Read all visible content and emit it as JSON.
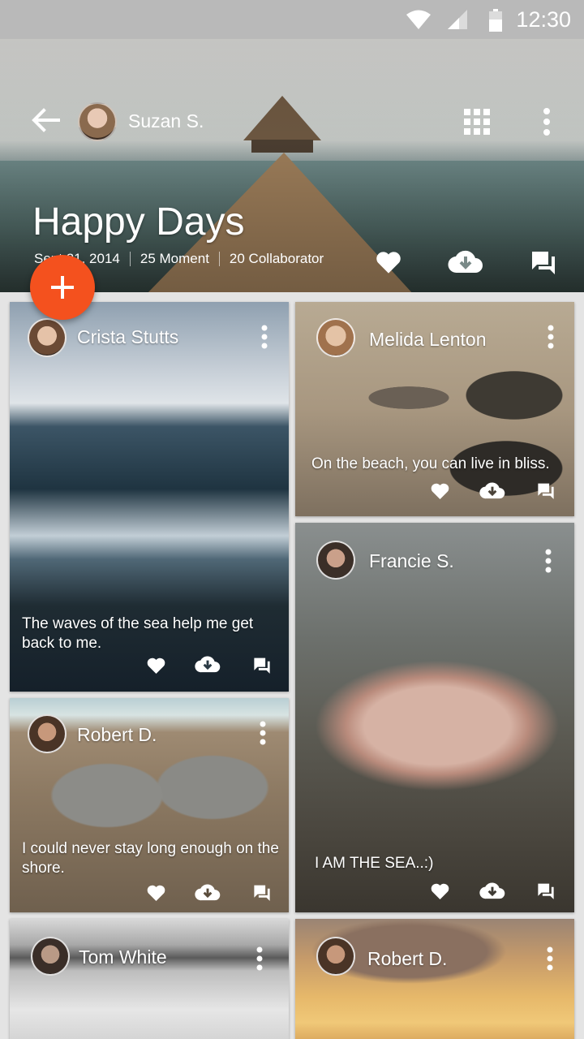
{
  "status_bar": {
    "time": "12:30"
  },
  "header": {
    "owner_name": "Suzan S.",
    "album_title": "Happy Days",
    "date": "Sept 21, 2014",
    "moments": "25 Moment",
    "collaborators": "20 Collaborator"
  },
  "colors": {
    "fab": "#f4511e",
    "status_bar": "#b9b9b9",
    "background": "#e4e4e4"
  },
  "cards": [
    {
      "name": "Crista Stutts",
      "caption": "The waves of the sea help me get back to me."
    },
    {
      "name": "Melida Lenton",
      "caption": "On the beach, you can live in bliss."
    },
    {
      "name": "Francie S.",
      "caption": "I AM THE SEA..:)"
    },
    {
      "name": "Robert D.",
      "caption": "I could never stay long enough on the shore."
    },
    {
      "name": "Tom White",
      "caption": ""
    },
    {
      "name": "Robert D.",
      "caption": ""
    }
  ],
  "icons": [
    "back-arrow-icon",
    "grid-icon",
    "more-vert-icon",
    "heart-icon",
    "cloud-download-icon",
    "comment-icon",
    "add-icon",
    "wifi-icon",
    "signal-icon",
    "battery-icon"
  ]
}
